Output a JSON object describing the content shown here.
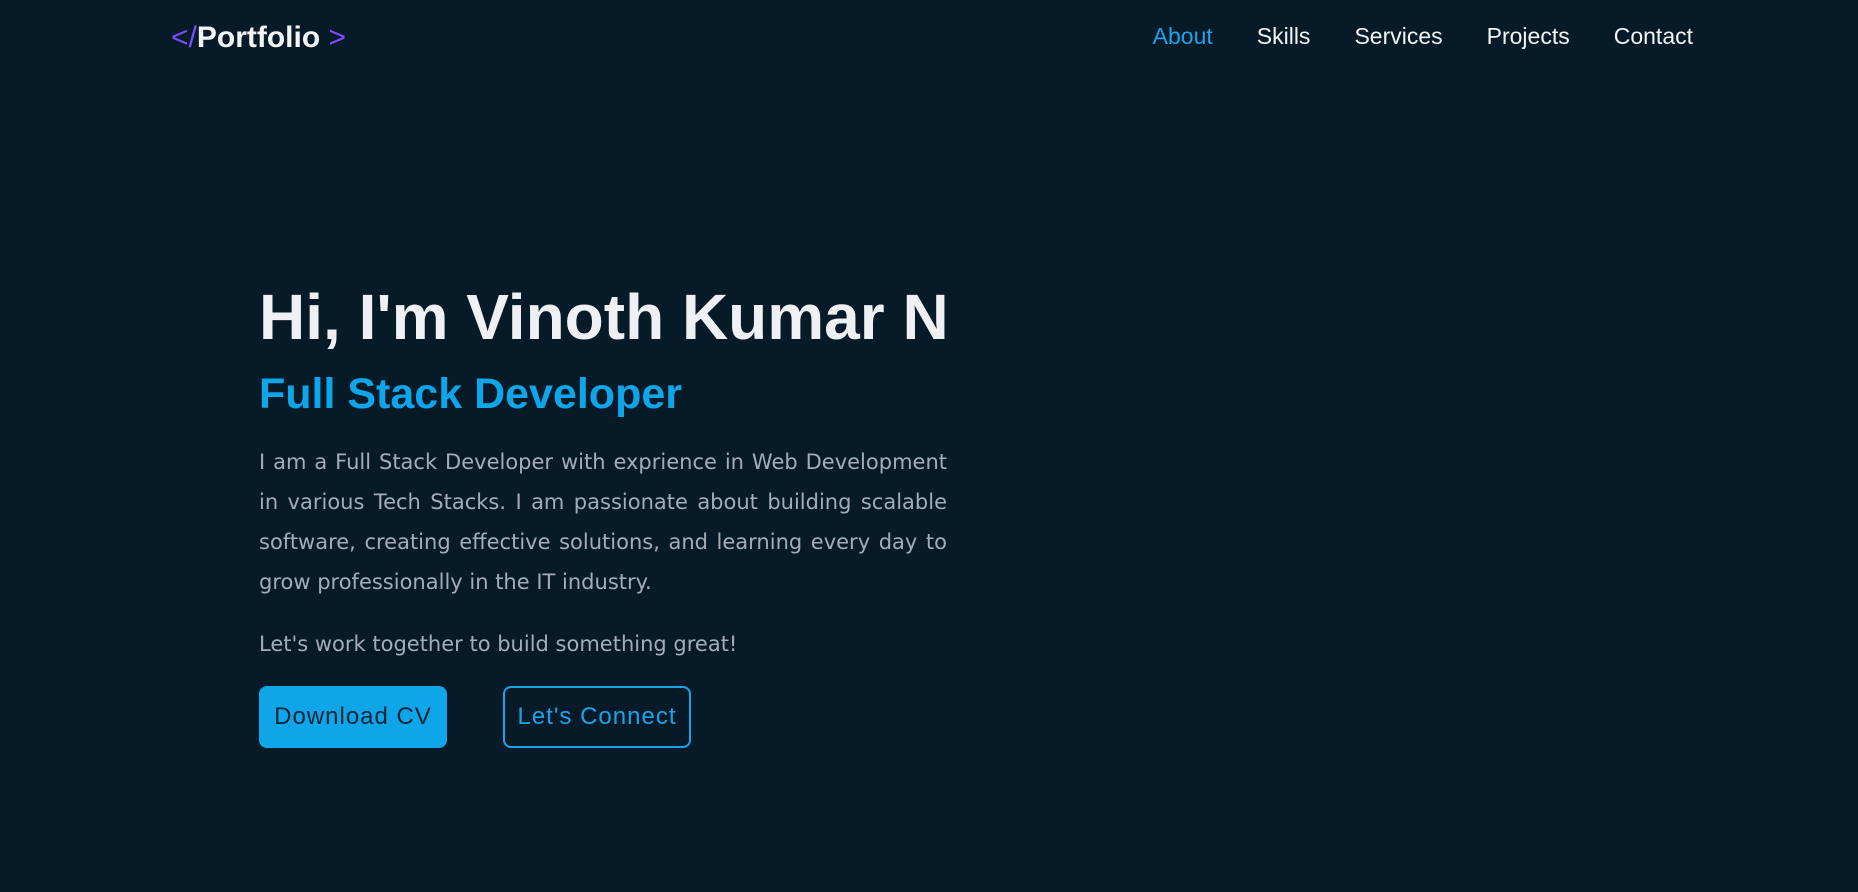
{
  "logo": {
    "open_tag": "</",
    "name": "Portfolio",
    "close_tag": " >"
  },
  "nav": {
    "items": [
      {
        "label": "About",
        "active": true
      },
      {
        "label": "Skills",
        "active": false
      },
      {
        "label": "Services",
        "active": false
      },
      {
        "label": "Projects",
        "active": false
      },
      {
        "label": "Contact",
        "active": false
      }
    ]
  },
  "hero": {
    "title": "Hi, I'm Vinoth Kumar N",
    "subtitle": "Full Stack Developer",
    "description": "I am a Full Stack Developer with exprience in Web Development in various Tech Stacks. I am passionate about building scalable software, creating effective solutions, and learning every day to grow professionally in the IT industry.",
    "cta_text": "Let's work together to build something great!",
    "primary_button": "Download CV",
    "secondary_button": "Let's Connect"
  },
  "colors": {
    "background": "#071a28",
    "accent": "#0ea5e9",
    "logo_accent": "#7c4dff",
    "text": "#f3f4f6",
    "muted_text": "#a3adb8"
  }
}
